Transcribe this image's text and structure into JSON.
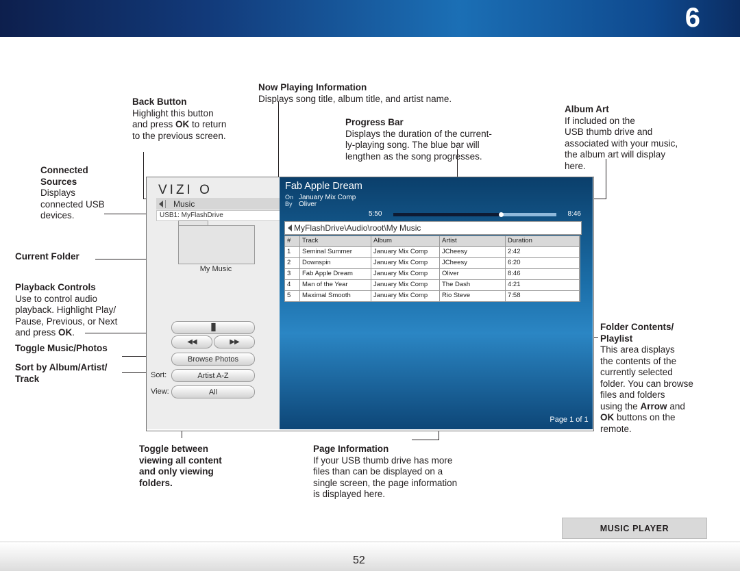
{
  "page": {
    "chapter_number": "6",
    "page_number": "52",
    "section_tag": "MUSIC PLAYER"
  },
  "annotations": {
    "back_button": {
      "title": "Back Button",
      "body_1": "Highlight this button",
      "body_2a": "and press ",
      "body_2b": "OK",
      "body_2c": " to return",
      "body_3": "to the previous screen."
    },
    "now_playing": {
      "title": "Now Playing Information",
      "body": "Displays song title, album title, and artist name."
    },
    "album_art": {
      "title": "Album Art",
      "body_1": "If included on the",
      "body_2": "USB thumb drive and",
      "body_3": "associated with your music,",
      "body_4": "the album art will display",
      "body_5": "here."
    },
    "progress_bar": {
      "title": "Progress Bar",
      "body_1": "Displays the duration of the current-",
      "body_2": "ly-playing song. The blue bar will",
      "body_3": "lengthen as the song progresses."
    },
    "connected_sources": {
      "title_1": "Connected",
      "title_2": "Sources",
      "body_1": "Displays",
      "body_2": "connected USB",
      "body_3": "devices."
    },
    "current_folder": {
      "title": "Current Folder"
    },
    "playback_controls": {
      "title": "Playback Controls",
      "body_1": "Use to control audio",
      "body_2": "playback. Highlight Play/",
      "body_3": "Pause, Previous, or Next",
      "body_4a": "and press ",
      "body_4b": "OK",
      "body_4c": "."
    },
    "toggle_music_photos": {
      "title": "Toggle Music/Photos"
    },
    "sort_by": {
      "title_1": "Sort by Album/Artist/",
      "title_2": "Track"
    },
    "toggle_view": {
      "line_1": "Toggle between",
      "line_2": "viewing all content",
      "line_3": "and only viewing",
      "line_4": "folders."
    },
    "page_information": {
      "title": "Page Information",
      "body_1": "If your USB thumb drive has more",
      "body_2": "files than can be displayed on a",
      "body_3": "single screen, the page information",
      "body_4": "is displayed here."
    },
    "folder_contents": {
      "title_1": "Folder Contents/",
      "title_2": "Playlist",
      "body_1": "This area displays",
      "body_2": "the contents of the",
      "body_3": "currently selected",
      "body_4": "folder. You can browse",
      "body_5": "files and folders",
      "body_6a": "using the ",
      "body_6b": "Arrow",
      "body_6c": " and",
      "body_7a": "OK",
      "body_7b": " buttons on the",
      "body_8": "remote."
    }
  },
  "tv": {
    "brand": "VIZI O",
    "menu_label": "Music",
    "source_row": "USB1: MyFlashDrive",
    "folder_label": "My Music",
    "browse_photos_button": "Browse Photos",
    "sort_label": "Sort:",
    "sort_value": "Artist A-Z",
    "view_label": "View:",
    "view_value": "All",
    "now_playing": {
      "song": "Fab Apple Dream",
      "on_label": "On",
      "album": "January Mix Comp",
      "by_label": "By",
      "artist": "Oliver",
      "elapsed": "5:50",
      "total": "8:46",
      "progress_percent": 66
    },
    "path": "MyFlashDrive\\Audio\\root\\My Music",
    "table": {
      "headers": [
        "#",
        "Track",
        "Album",
        "Artist",
        "Duration"
      ],
      "rows": [
        [
          "1",
          "Seminal Summer",
          "January Mix Comp",
          "JCheesy",
          "2:42"
        ],
        [
          "2",
          "Downspin",
          "January Mix Comp",
          "JCheesy",
          "6:20"
        ],
        [
          "3",
          "Fab Apple Dream",
          "January Mix Comp",
          "Oliver",
          "8:46"
        ],
        [
          "4",
          "Man of the Year",
          "January Mix Comp",
          "The Dash",
          "4:21"
        ],
        [
          "5",
          "Maximal Smooth",
          "January Mix Comp",
          "Rio Steve",
          "7:58"
        ]
      ]
    },
    "page_info": "Page 1 of 1"
  }
}
